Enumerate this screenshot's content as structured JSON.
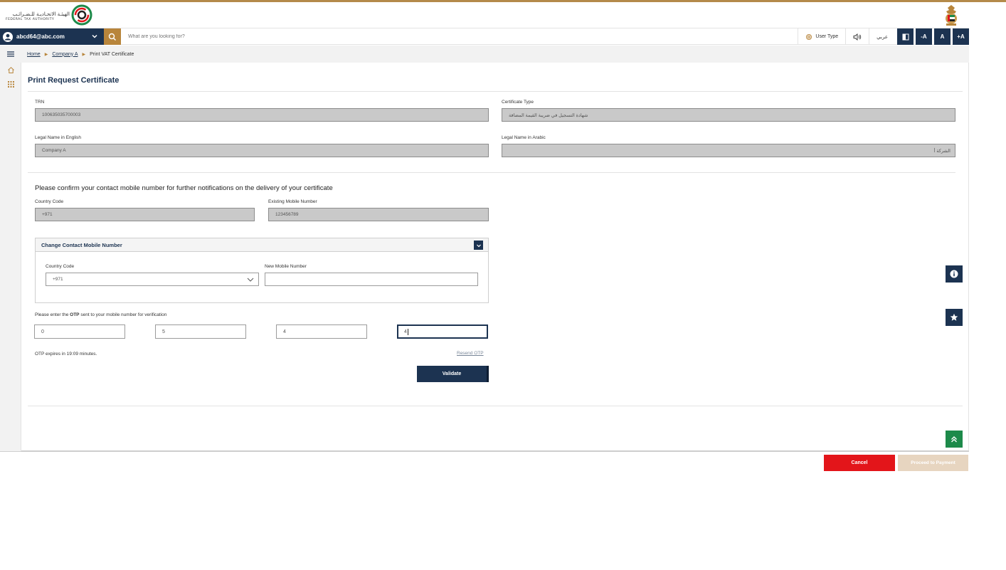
{
  "header": {
    "logo_ar": "الهيئـة الاتحـاديـة للـضـرائـب",
    "logo_en": "FEDERAL TAX AUTHORITY",
    "logo_icon": "fta-swirl-logo",
    "emblem_icon": "uae-emblem"
  },
  "navbar": {
    "user_email": "abcd64@abc.com",
    "search_placeholder": "What are you looking for?",
    "user_type": "User Type",
    "language": "عربي",
    "font_decrease": "-A",
    "font_normal": "A",
    "font_increase": "+A"
  },
  "breadcrumb": {
    "home": "Home",
    "company": "Company A",
    "current": "Print VAT Certificate"
  },
  "page": {
    "title": "Print Request Certificate"
  },
  "form": {
    "trn_label": "TRN",
    "trn_value": "100635035700003",
    "cert_type_label": "Certificate Type",
    "cert_type_value": "شهادة التسجيل في ضريبة القيمة المضافة",
    "legal_en_label": "Legal Name in English",
    "legal_en_value": "Company A",
    "legal_ar_label": "Legal Name in Arabic",
    "legal_ar_value": "الشركة أ"
  },
  "contact": {
    "confirm_text": "Please confirm your contact mobile number for further notifications on the delivery of your certificate",
    "country_code_label": "Country Code",
    "country_code_value": "+971",
    "existing_label": "Existing Mobile Number",
    "existing_value": "123456789"
  },
  "change_panel": {
    "title": "Change Contact Mobile Number",
    "country_code_label": "Country Code",
    "country_code_selected": "+971",
    "new_mobile_label": "New Mobile Number",
    "new_mobile_value": ""
  },
  "otp": {
    "label_prefix": "Please enter the ",
    "label_bold": "OTP",
    "label_suffix": " sent to your mobile number for verification",
    "digits": [
      "0",
      "5",
      "4",
      "4"
    ],
    "expires_text": "OTP expires in 19:09 minutes.",
    "resend_label": "Resend OTP",
    "validate_label": "Validate"
  },
  "footer": {
    "cancel_label": "Cancel",
    "proceed_label": "Proceed to Payment"
  },
  "colors": {
    "navy": "#1c3351",
    "gold": "#b8853b",
    "cancel_red": "#e3151a",
    "proceed_disabled": "#e7d5c0",
    "scroll_green": "#1d8a4a"
  }
}
